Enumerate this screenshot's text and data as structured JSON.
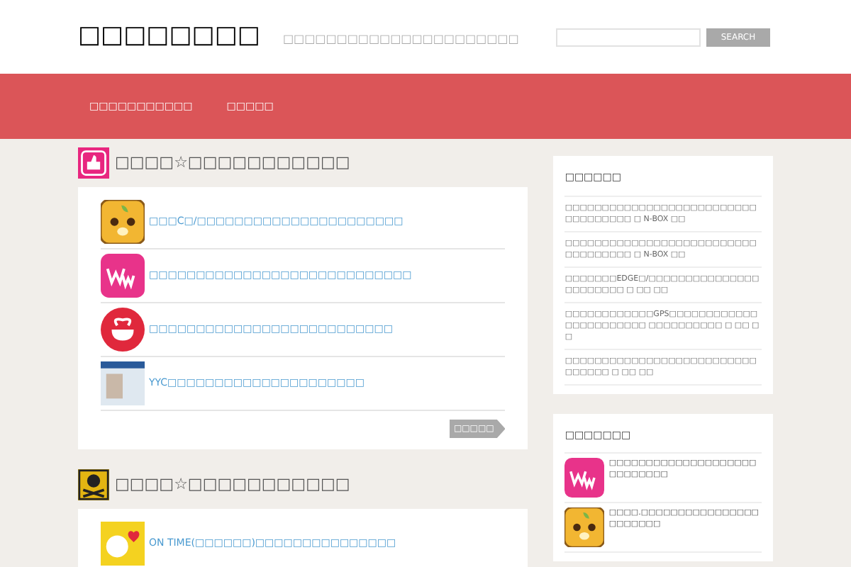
{
  "site": {
    "title": "□□□□□□□□",
    "tagline": "□□□□□□□□□□□□□□□□□□□□□□"
  },
  "search": {
    "button": "SEARCH"
  },
  "nav": [
    "□□□□□□□□□□□",
    "□□□□□"
  ],
  "sections": [
    {
      "heading": "□□□□☆□□□□□□□□□□□",
      "kind": "thumb",
      "items": [
        {
          "kind": "bear",
          "text": "□□□C□/□□□□□□□□□□□□□□□□□□□□□□"
        },
        {
          "kind": "ww",
          "text": "□□□□□□□□□□□□□□□□□□□□□□□□□□□□"
        },
        {
          "kind": "cup",
          "text": "□□□□□□□□□□□□□□□□□□□□□□□□□□"
        },
        {
          "kind": "photo",
          "text": "YYC□□□□□□□□□□□□□□□□□□□□□"
        }
      ],
      "more": "□□□□□"
    },
    {
      "heading": "□□□□☆□□□□□□□□□□□",
      "kind": "skull",
      "items": [
        {
          "kind": "heart",
          "text": "ON TIME(□□□□□□)□□□□□□□□□□□□□□□"
        }
      ]
    }
  ],
  "widgets": [
    {
      "title": "□□□□□□",
      "kind": "text",
      "items": [
        "□□□□□□□□□□□□□□□□□□□□□□□□□□□□□□□□□□□ □ N-BOX □□",
        "□□□□□□□□□□□□□□□□□□□□□□□□□□□□□□□□□□□ □ N-BOX □□",
        "□□□□□□□EDGE□/□□□□□□□□□□□□□□□□□□□□□□□ □ □□ □□",
        "□□□□□□□□□□□□GPS□□□□□□□□□□□□□□□□□□□□□□□ □□□□□□□□□□ □ □□ □□",
        "□□□□□□□□□□□□□□□□□□□□□□□□□□□□□□□□ □ □□ □□"
      ]
    },
    {
      "title": "□□□□□□□",
      "kind": "icons",
      "items": [
        {
          "kind": "ww",
          "text": "□□□□□□□□□□□□□□□□□□□□□□□□□□□□"
        },
        {
          "kind": "bear",
          "text": "□□□□.□□□□□□□□□□□□□□□□□□□□□□□"
        }
      ]
    }
  ]
}
